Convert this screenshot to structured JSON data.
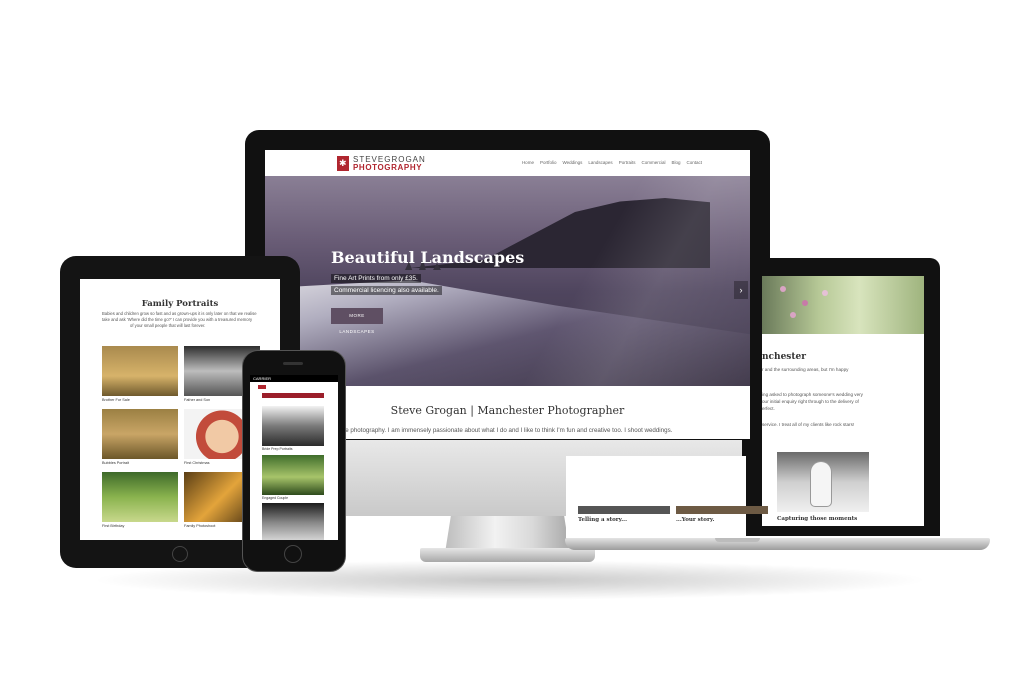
{
  "desktop": {
    "logo_top": "STEVEGROGAN",
    "logo_bottom": "PHOTOGRAPHY",
    "nav": [
      "Home",
      "Portfolio",
      "Weddings",
      "Landscapes",
      "Portraits",
      "Commercial",
      "Blog",
      "Contact"
    ],
    "hero": {
      "title": "Beautiful Landscapes",
      "line1": "Fine Art Prints from only £35.",
      "line2": "Commercial licencing also available.",
      "button": "MORE LANDSCAPES"
    },
    "heading": "Steve Grogan | Manchester Photographer",
    "intro": "...ve photography. I am immensely passionate about what I do and I like to think I'm fun and creative too. I shoot weddings."
  },
  "laptop": {
    "heading": "nchester",
    "lines": [
      "r and the surrounding areas, but I'm happy",
      "ing asked to photograph someone's wedding very",
      "our initial enquiry right through to the delivery of",
      "erfect.",
      "service. I treat all of my clients like rock stars!"
    ],
    "captions": [
      "Telling a story...",
      "...Your story.",
      "Capturing those moments"
    ]
  },
  "tablet": {
    "title": "Family Portraits",
    "text_lines": [
      "Babies and children grow so fast and as grown-ups it is only later on that we realise",
      "take and ask 'Where did the time go?' I can provide you with a treasured memory",
      "of your small people that will last forever."
    ],
    "captions": [
      "Brother For Sale",
      "Father and Son",
      "Bubbles Portrait",
      "First Christmas",
      "First Birthday",
      "Family Photoshoot"
    ]
  },
  "phone": {
    "carrier": "CARRIER",
    "captions": [
      "Bride Prep Portraits",
      "Engaged Couple"
    ]
  },
  "colors": {
    "brand_red": "#b0262f",
    "hero_button": "#5f4f63"
  }
}
